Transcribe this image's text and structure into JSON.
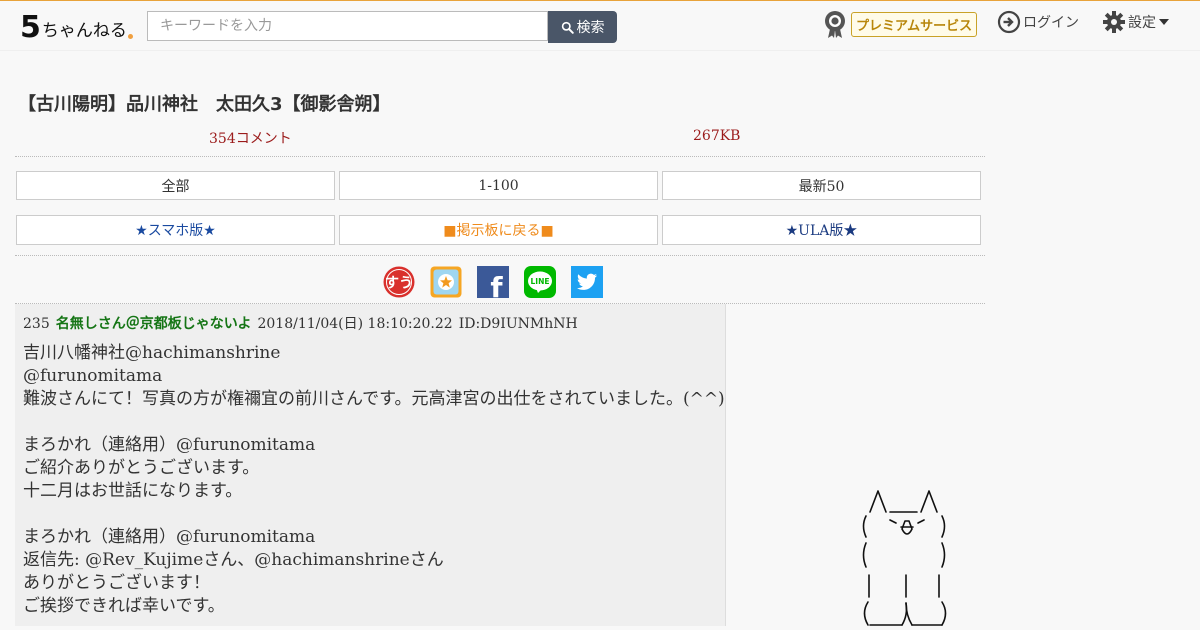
{
  "header": {
    "logo_big": "5",
    "logo_small": "ちゃんねる",
    "search": {
      "placeholder": "キーワードを入力",
      "value": ""
    },
    "search_button_label": "検索",
    "premium_label": "プレミアムサービス",
    "login_label": "ログイン",
    "settings_label": "設定"
  },
  "thread": {
    "title": "【古川陽明】品川神社　太田久3【御影舎朔】",
    "comments": "354コメント",
    "size": "267KB"
  },
  "nav": {
    "row1": [
      "全部",
      "1-100",
      "最新50"
    ],
    "row2": [
      "★スマホ版★",
      "■掲示板に戻る■",
      "★ULA版★"
    ]
  },
  "share": {
    "icons": [
      "sumaho-ichiban-icon",
      "bookmark-icon",
      "facebook-icon",
      "line-icon",
      "twitter-icon"
    ],
    "sumaho_text": "すう",
    "line_text": "LINE",
    "facebook_text": "f"
  },
  "post": {
    "number": "235",
    "name": "名無しさん＠京都板じゃないよ",
    "date": "2018/11/04(日) 18:10:20.22",
    "id": "ID:D9IUNMhNH",
    "body": "吉川八幡神社@hachimanshrine\n@furunomitama\n難波さんにて！写真の方が権禰宜の前川さんです。元高津宮の出仕をされていました。(^^)\n\nまろかれ（連絡用）@furunomitama\nご紹介ありがとうございます。\n十二月はお世話になります。\n\nまろかれ（連絡用）@furunomitama\n返信先: @Rev_Kujimeさん、@hachimanshrineさん\nありがとうございます！\nご挨拶できれば幸いです。"
  },
  "colors": {
    "accent_line": "#e8a33a",
    "search_button": "#4a5668",
    "poster_name": "#157515",
    "meta_red": "#9b1b1b",
    "nav_blue": "#1a4aa0",
    "nav_orange": "#ef8b1c",
    "premium_gold": "#b8860b"
  }
}
